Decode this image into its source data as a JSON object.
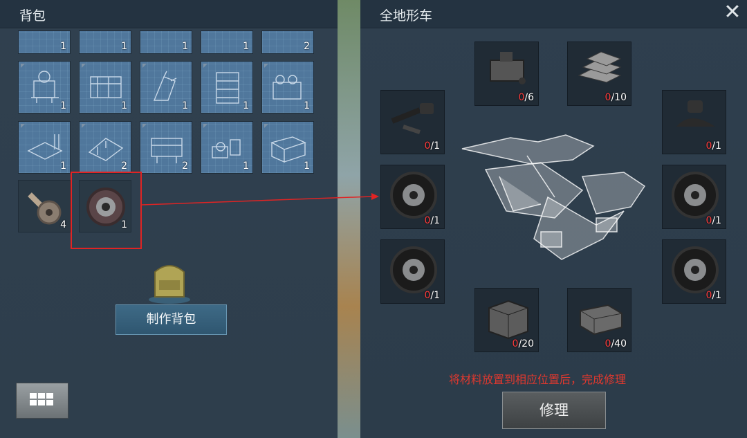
{
  "inventory": {
    "title": "背包",
    "top_row_counts": [
      "1",
      "1",
      "1",
      "1",
      "2"
    ],
    "row2_counts": [
      "1",
      "1",
      "1",
      "1",
      "1"
    ],
    "row3_counts": [
      "1",
      "2",
      "2",
      "1",
      "1"
    ],
    "row4_counts": [
      "4",
      "1"
    ],
    "craft_backpack_label": "制作背包"
  },
  "repair": {
    "title": "全地形车",
    "close_symbol": "✕",
    "slots": [
      {
        "name": "engine",
        "current": "0",
        "required": "/6",
        "icon": "engine-icon"
      },
      {
        "name": "metal-ingots",
        "current": "0",
        "required": "/10",
        "icon": "ingot-stack-icon"
      },
      {
        "name": "handlebar",
        "current": "0",
        "required": "/1",
        "icon": "handlebar-icon"
      },
      {
        "name": "seat",
        "current": "0",
        "required": "/1",
        "icon": "seat-icon"
      },
      {
        "name": "wheel-left-front",
        "current": "0",
        "required": "/1",
        "icon": "wheel-icon"
      },
      {
        "name": "wheel-right-front",
        "current": "0",
        "required": "/1",
        "icon": "wheel-icon"
      },
      {
        "name": "wheel-left-rear",
        "current": "0",
        "required": "/1",
        "icon": "wheel-icon"
      },
      {
        "name": "wheel-right-rear",
        "current": "0",
        "required": "/1",
        "icon": "wheel-icon"
      },
      {
        "name": "metal-crate",
        "current": "0",
        "required": "/20",
        "icon": "crate-icon"
      },
      {
        "name": "metal-sheet",
        "current": "0",
        "required": "/40",
        "icon": "metal-block-icon"
      }
    ],
    "hint": "将材料放置到相应位置后，完成修理",
    "repair_label": "修理"
  },
  "colors": {
    "accent_red": "#e0382e",
    "panel_bg": "#2f4050"
  }
}
